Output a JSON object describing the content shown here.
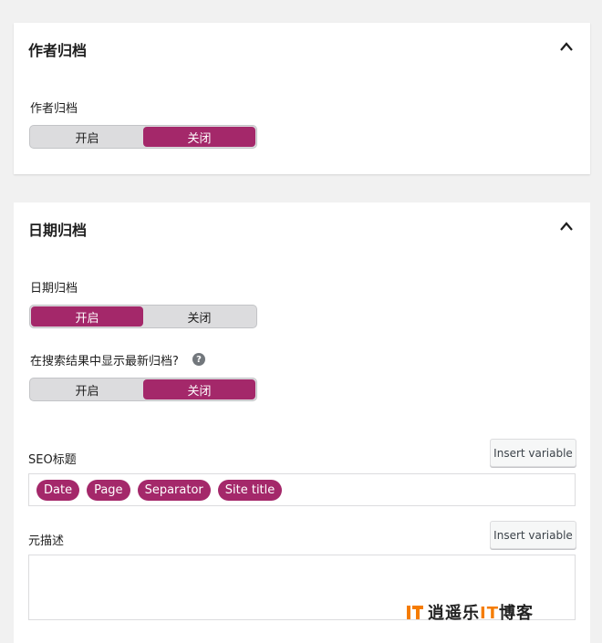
{
  "author_panel": {
    "title": "作者归档",
    "field_label": "作者归档",
    "toggle": {
      "on_label": "开启",
      "off_label": "关闭",
      "selected": "关闭"
    }
  },
  "date_panel": {
    "title": "日期归档",
    "archive_field": {
      "label": "日期归档",
      "toggle": {
        "on_label": "开启",
        "off_label": "关闭",
        "selected": "开启"
      }
    },
    "search_field": {
      "label": "在搜索结果中显示最新归档?",
      "help_icon": "?",
      "toggle": {
        "on_label": "开启",
        "off_label": "关闭",
        "selected": "关闭"
      }
    },
    "seo_title": {
      "label": "SEO标题",
      "insert_label": "Insert variable",
      "variables": [
        "Date",
        "Page",
        "Separator",
        "Site title"
      ]
    },
    "meta_description": {
      "label": "元描述",
      "insert_label": "Insert variable",
      "value": ""
    }
  },
  "watermark": {
    "logo_icon": "it-logo-icon",
    "text_prefix": "逍遥乐",
    "text_it": "IT",
    "text_suffix": "博客"
  },
  "colors": {
    "accent": "#a4286a",
    "toggle_bg": "#dcdcde",
    "page_bg": "#f1f1f1",
    "watermark_it": "#f57c00"
  }
}
